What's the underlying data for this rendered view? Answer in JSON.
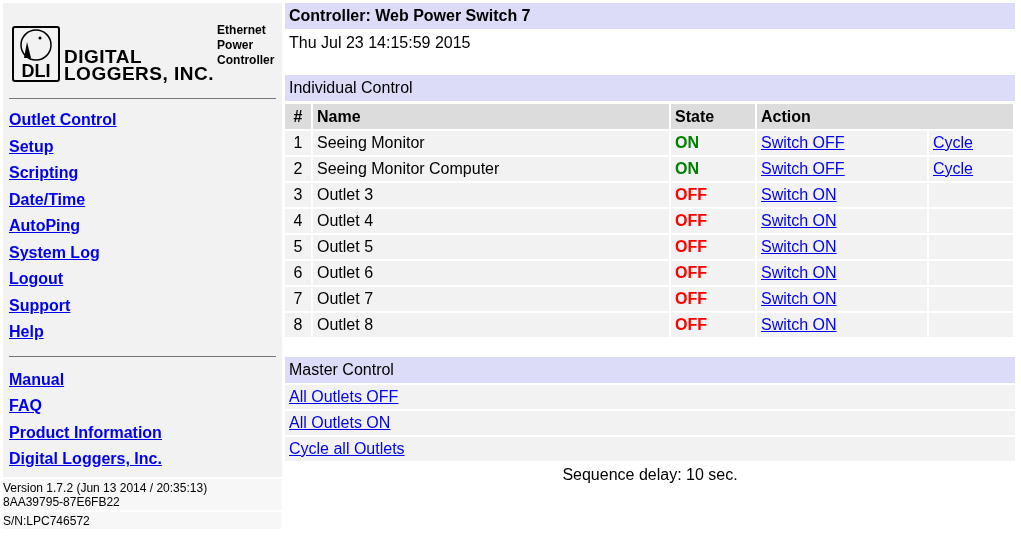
{
  "logo": {
    "badge": "DLI",
    "line_1": "DIGITAL",
    "line_2": "LOGGERS, INC.",
    "product": [
      "Ethernet",
      "Power",
      "Controller"
    ]
  },
  "nav": [
    "Outlet Control",
    "Setup",
    "Scripting",
    "Date/Time",
    "AutoPing",
    "System Log",
    "Logout",
    "Support",
    "Help"
  ],
  "links": [
    "Manual",
    "FAQ",
    "Product Information",
    "Digital Loggers, Inc."
  ],
  "version": {
    "build": "Version 1.7.2 (Jun 13 2014 / 20:35:13)",
    "id": "8AA39795-87E6FB22",
    "serial": "S/N:LPC746572"
  },
  "controller": {
    "title": "Controller: Web Power Switch 7",
    "datetime": "Thu Jul 23 14:15:59 2015"
  },
  "individual": {
    "heading": "Individual Control",
    "columns": [
      "#",
      "Name",
      "State",
      "Action"
    ],
    "rows": [
      {
        "num": "1",
        "name": "Seeing Monitor",
        "on": true,
        "state": "ON",
        "action": "Switch OFF",
        "cycle": "Cycle"
      },
      {
        "num": "2",
        "name": "Seeing Monitor Computer",
        "on": true,
        "state": "ON",
        "action": "Switch OFF",
        "cycle": "Cycle"
      },
      {
        "num": "3",
        "name": "Outlet 3",
        "on": false,
        "state": "OFF",
        "action": "Switch ON"
      },
      {
        "num": "4",
        "name": "Outlet 4",
        "on": false,
        "state": "OFF",
        "action": "Switch ON"
      },
      {
        "num": "5",
        "name": "Outlet 5",
        "on": false,
        "state": "OFF",
        "action": "Switch ON"
      },
      {
        "num": "6",
        "name": "Outlet 6",
        "on": false,
        "state": "OFF",
        "action": "Switch ON"
      },
      {
        "num": "7",
        "name": "Outlet 7",
        "on": false,
        "state": "OFF",
        "action": "Switch ON"
      },
      {
        "num": "8",
        "name": "Outlet 8",
        "on": false,
        "state": "OFF",
        "action": "Switch ON"
      }
    ]
  },
  "master": {
    "heading": "Master Control",
    "actions": [
      "All Outlets OFF",
      "All Outlets ON",
      "Cycle all Outlets"
    ],
    "delay": "Sequence delay: 10 sec."
  }
}
